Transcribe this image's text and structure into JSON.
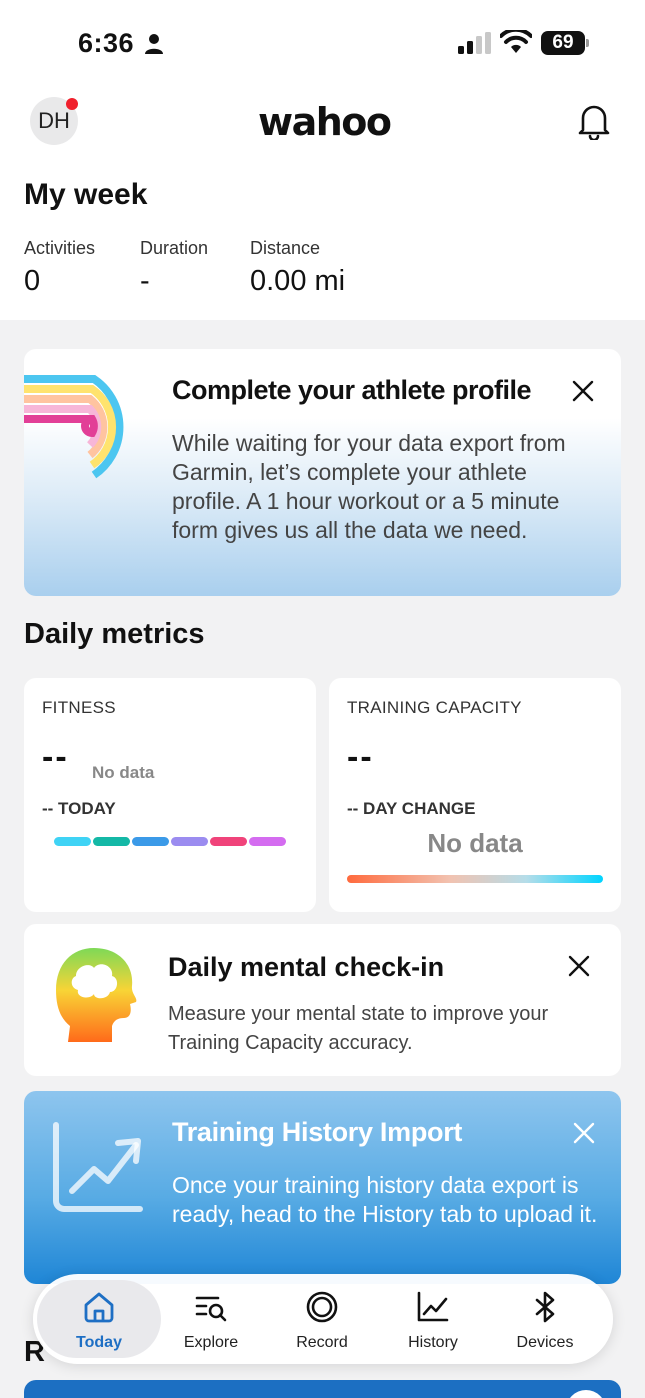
{
  "status_bar": {
    "time": "6:36",
    "battery": "69"
  },
  "header": {
    "avatar_initials": "DH",
    "logo": "wahoo"
  },
  "week": {
    "title": "My week",
    "stats": [
      {
        "label": "Activities",
        "value": "0"
      },
      {
        "label": "Duration",
        "value": "-"
      },
      {
        "label": "Distance",
        "value": "0.00 mi"
      }
    ]
  },
  "profile_card": {
    "title": "Complete your athlete profile",
    "description": "While waiting for your data export from Garmin, let’s complete your athlete profile. A 1 hour workout or a 5 minute form gives us all the data we need."
  },
  "daily_metrics": {
    "title": "Daily metrics",
    "fitness": {
      "label": "FITNESS",
      "value": "--",
      "no_data": "No data",
      "sub": "-- TODAY"
    },
    "training_capacity": {
      "label": "TRAINING CAPACITY",
      "value": "--",
      "sub": "-- DAY CHANGE",
      "no_data": "No data"
    },
    "fitness_segment_colors": [
      "#3fd3f5",
      "#14b8a6",
      "#3b9ae8",
      "#9b8cf0",
      "#f0437a",
      "#d46cf0"
    ]
  },
  "mental_card": {
    "title": "Daily mental check-in",
    "description": "Measure your mental state to improve your Training Capacity accuracy."
  },
  "import_card": {
    "title": "Training History Import",
    "description": "Once your training history data export is ready, head to the History tab to upload it."
  },
  "recent_partial": "R",
  "tabbar": {
    "tabs": [
      {
        "label": "Today",
        "icon": "home-icon",
        "active": true
      },
      {
        "label": "Explore",
        "icon": "explore-icon"
      },
      {
        "label": "Record",
        "icon": "record-icon"
      },
      {
        "label": "History",
        "icon": "history-chart-icon"
      },
      {
        "label": "Devices",
        "icon": "bluetooth-icon"
      }
    ]
  },
  "colors": {
    "accent": "#1e6fc4",
    "notification": "#f0202c"
  }
}
